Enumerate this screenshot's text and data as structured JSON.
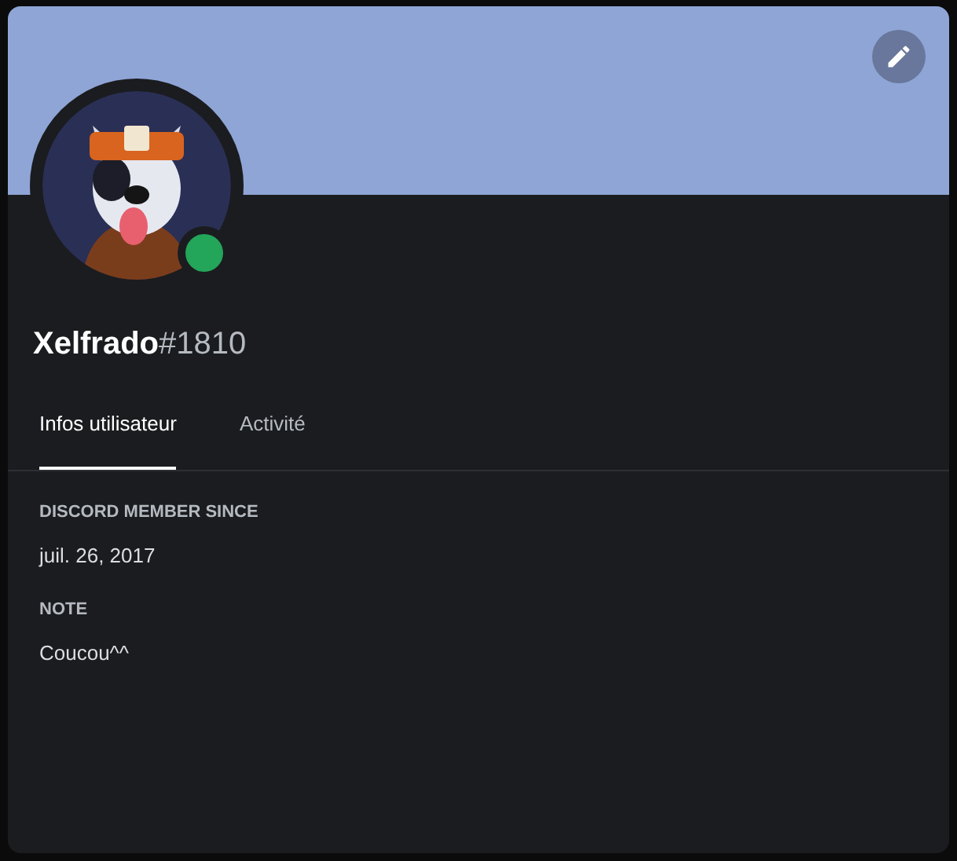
{
  "profile": {
    "username": "Xelfrado",
    "discriminator": "#1810",
    "online": true
  },
  "tabs": [
    {
      "label": "Infos utilisateur",
      "selected": true
    },
    {
      "label": "Activité",
      "selected": false
    }
  ],
  "sections": [
    {
      "heading": "DISCORD MEMBER SINCE",
      "text": "juil. 26, 2017"
    },
    {
      "heading": "NOTE",
      "text": "Coucou^^"
    }
  ]
}
